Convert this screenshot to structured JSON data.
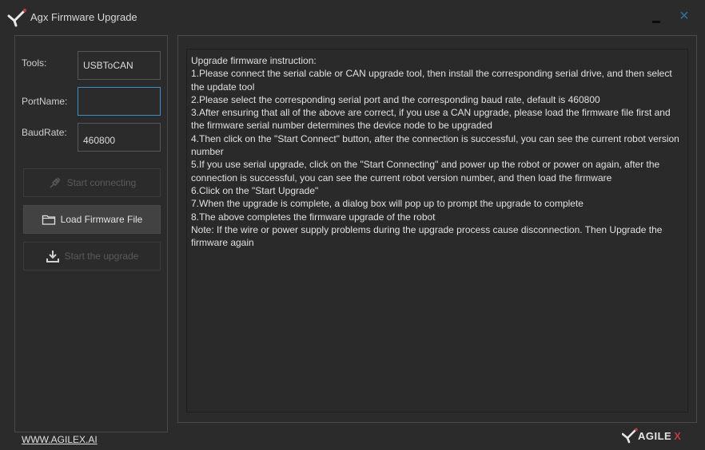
{
  "window": {
    "title": "Agx Firmware Upgrade",
    "minimize_icon": "minimize-icon",
    "close_symbol": "✕"
  },
  "form": {
    "tools_label": "Tools:",
    "tools_value": "USBToCAN",
    "portname_label": "PortName:",
    "portname_value": "",
    "baudrate_label": "BaudRate:",
    "baudrate_value": "460800"
  },
  "buttons": {
    "start_connecting": "Start connecting",
    "load_firmware": "Load Firmware File",
    "start_upgrade": "Start the upgrade"
  },
  "instructions": {
    "lines": [
      "Upgrade firmware instruction:",
      "1.Please connect the serial cable or CAN upgrade tool, then install the corresponding serial drive, and then select the update tool",
      "2.Please select the corresponding serial port and the corresponding baud rate, default is 460800",
      "3.After ensuring that all of the above are correct, if you use a CAN upgrade, please load the firmware file first and the firmware serial number determines the device node to be upgraded",
      "4.Then click on the \"Start Connect\" button, after the connection is successful, you can see the current robot version number",
      "5.If you use serial upgrade, click on the \"Start Connecting\" and power up the robot or power on again, after the connection is successful, you can see the current robot version number, and then load the firmware",
      "6.Click on the \"Start Upgrade\"",
      "7.When the upgrade is complete, a dialog box will pop up to prompt the upgrade to complete",
      "8.The above completes the firmware upgrade of the robot",
      "Note: If the wire or power supply problems during the upgrade process cause disconnection. Then Upgrade the firmware again"
    ]
  },
  "footer": {
    "link": "WWW.AGILEX.AI",
    "brand_text": "AGILE",
    "brand_x": "X"
  },
  "colors": {
    "background": "#2b2b2b",
    "focus_border": "#3a8fc7",
    "brand_red": "#c23a3a",
    "close_blue": "#2d6f9a"
  }
}
